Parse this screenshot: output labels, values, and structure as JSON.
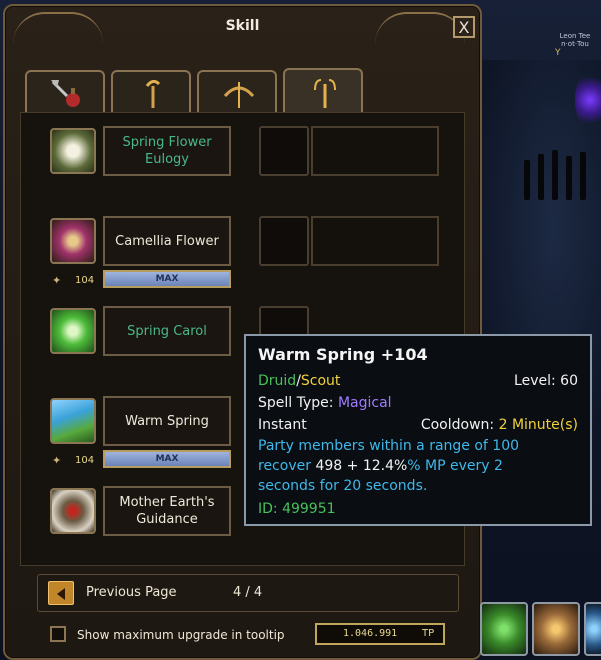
{
  "window": {
    "title": "Skill",
    "close_glyph": "X"
  },
  "tabs": [
    {
      "icon": "axe-potion-icon",
      "active": false
    },
    {
      "icon": "staff-icon",
      "active": false
    },
    {
      "icon": "bow-icon",
      "active": false
    },
    {
      "icon": "trident-icon",
      "active": true
    }
  ],
  "skills": [
    {
      "name": "Spring Flower Eulogy",
      "color": "green",
      "level": null,
      "max": false
    },
    {
      "name": "Camellia Flower",
      "color": "white",
      "level": "104",
      "max": true,
      "max_label": "MAX"
    },
    {
      "name": "Spring Carol",
      "color": "green",
      "level": null,
      "max": false
    },
    {
      "name": "Warm Spring",
      "color": "white",
      "level": "104",
      "max": true,
      "max_label": "MAX"
    },
    {
      "name": "Mother Earth's Guidance",
      "color": "white",
      "level": null,
      "max": false
    }
  ],
  "pager": {
    "prev_label": "Previous Page",
    "page": "4 / 4"
  },
  "footer": {
    "checkbox_label": "Show maximum upgrade in tooltip",
    "checked": false,
    "tp_value": "1.046.991",
    "tp_unit": "TP"
  },
  "tooltip": {
    "title": "Warm Spring +104",
    "class1": "Druid",
    "sep": "/",
    "class2": "Scout",
    "level_label": "Level:",
    "level_value": "60",
    "spell_type_label": "Spell Type:",
    "spell_type_value": "Magical",
    "cast": "Instant",
    "cooldown_label": "Cooldown:",
    "cooldown_value": "2 Minute(s)",
    "desc_a": "Party members within a range of 100",
    "desc_b1": "recover",
    "desc_b2": "498",
    "desc_b3": "+",
    "desc_b4": "12.4%",
    "desc_b5": "% MP every 2",
    "desc_c": "seconds for 20 seconds.",
    "id_text": "ID: 499951"
  },
  "scene": {
    "npc_label": "Leon Tee\nn·ot·Tou",
    "npc_mark": "Y"
  },
  "colors": {
    "frame": "#6f5a3c",
    "green_text": "#49b98a",
    "tooltip_cyan": "#3fb8ea",
    "tooltip_yellow": "#f2d23b"
  }
}
